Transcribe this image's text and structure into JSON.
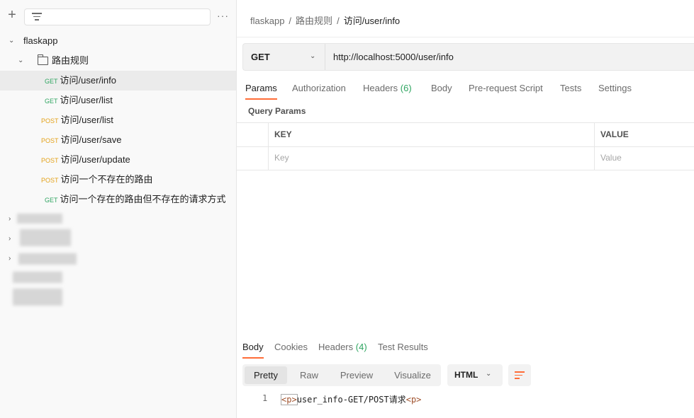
{
  "sidebar": {
    "plus_label": "+",
    "more_label": "···",
    "collection": "flaskapp",
    "folder": "路由规则",
    "requests": [
      {
        "method": "GET",
        "name": "访问/user/info"
      },
      {
        "method": "GET",
        "name": "访问/user/list"
      },
      {
        "method": "POST",
        "name": "访问/user/list"
      },
      {
        "method": "POST",
        "name": "访问/user/save"
      },
      {
        "method": "POST",
        "name": "访问/user/update"
      },
      {
        "method": "POST",
        "name": "访问一个不存在的路由"
      },
      {
        "method": "GET",
        "name": "访问一个存在的路由但不存在的请求方式"
      }
    ]
  },
  "breadcrumb": {
    "collection": "flaskapp",
    "folder": "路由规则",
    "current": "访问/user/info",
    "sep": "/"
  },
  "request": {
    "method": "GET",
    "url": "http://localhost:5000/user/info"
  },
  "request_tabs": {
    "params": "Params",
    "authorization": "Authorization",
    "headers": "Headers",
    "headers_count": "(6)",
    "body": "Body",
    "prerequest": "Pre-request Script",
    "tests": "Tests",
    "settings": "Settings"
  },
  "query_params": {
    "title": "Query Params",
    "key_header": "KEY",
    "value_header": "VALUE",
    "key_placeholder": "Key",
    "value_placeholder": "Value"
  },
  "response_tabs": {
    "body": "Body",
    "cookies": "Cookies",
    "headers": "Headers",
    "headers_count": "(4)",
    "test_results": "Test Results"
  },
  "response_view": {
    "pretty": "Pretty",
    "raw": "Raw",
    "preview": "Preview",
    "visualize": "Visualize",
    "format": "HTML"
  },
  "response_body": {
    "line_number": "1",
    "tag_open": "<p>",
    "text": "user_info-GET/POST请求",
    "tag_close": "<p>"
  },
  "colors": {
    "get": "#2fa561",
    "post": "#e3a21a",
    "accent": "#ff6c37"
  }
}
